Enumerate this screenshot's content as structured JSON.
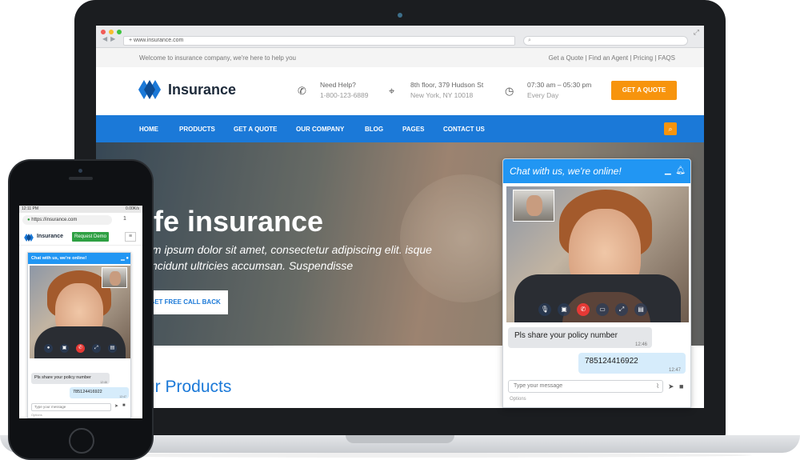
{
  "browser": {
    "url": "www.insurance.com",
    "traffic_colors": [
      "#f15b57",
      "#f7bd2e",
      "#3cc43f"
    ]
  },
  "site": {
    "topbar": {
      "welcome": "Welcome to insurance company, we're here to help you",
      "links": "Get a Quote | Find an Agent | Pricing | FAQS"
    },
    "brand": "Insurance",
    "info": {
      "help_title": "Need Help?",
      "help_phone": "1-800-123-6889",
      "address_line1": "8th floor, 379 Hudson St",
      "address_line2": "New York, NY 10018",
      "hours_line1": "07:30 am – 05:30 pm",
      "hours_line2": "Every Day"
    },
    "quote_button": "GET A QUOTE",
    "nav": [
      "HOME",
      "PRODUCTS",
      "GET A QUOTE",
      "OUR COMPANY",
      "BLOG",
      "PAGES",
      "CONTACT US"
    ],
    "hero": {
      "title": "ife insurance",
      "subtitle": "em ipsum dolor sit amet, consectetur adipiscing elit. isque tincidunt ultricies accumsan. Suspendisse",
      "button": "GET FREE CALL BACK"
    },
    "products_heading": "ur Products",
    "colors": {
      "nav": "#1b79d8",
      "accent": "#f7940d"
    }
  },
  "chat": {
    "header": "Chat with us, we're online!",
    "message_in": "Pls share your policy number",
    "message_in_time": "12:46",
    "message_out": "785124416922",
    "message_out_time": "12:47",
    "input_placeholder": "Type your message",
    "options_label": "Options",
    "control_icons": [
      "mic-icon",
      "camera-icon",
      "end-call-icon",
      "screen-share-icon",
      "fullscreen-icon",
      "chat-icon"
    ]
  },
  "phone": {
    "status_time": "12:11 PM",
    "status_right": "0.00K/s",
    "url": "https://insurance.com",
    "tab_count": "1",
    "brand": "Insurance",
    "demo_button": "Request Demo",
    "chat_header": "Chat with us, we're online!",
    "message_in": "Pls share your policy number",
    "message_in_time": "12:46",
    "message_out": "785124416922",
    "message_out_time": "12:47",
    "input_placeholder": "Type your message",
    "options_label": "Options"
  }
}
